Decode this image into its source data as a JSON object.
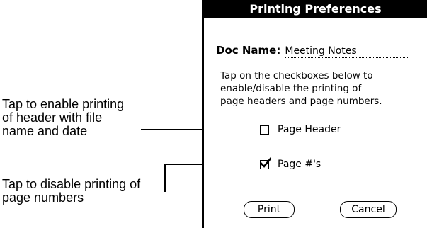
{
  "dialog": {
    "title": "Printing Preferences",
    "doc_name_label": "Doc Name:",
    "doc_name_value": "Meeting Notes",
    "instructions": "Tap on the checkboxes below to\nenable/disable the printing of\npage headers and page numbers.",
    "options": [
      {
        "label": "Page Header",
        "checked": false
      },
      {
        "label": "Page #'s",
        "checked": true
      }
    ],
    "buttons": {
      "print": "Print",
      "cancel": "Cancel"
    }
  },
  "callouts": [
    {
      "text": "Tap to enable printing\nof header with file\nname and date"
    },
    {
      "text": "Tap to disable printing of\npage numbers"
    }
  ]
}
